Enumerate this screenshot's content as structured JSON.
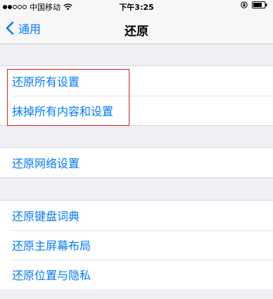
{
  "status_bar": {
    "carrier": "中国移动",
    "time": "下午3:25"
  },
  "nav": {
    "back_label": "通用",
    "title": "还原"
  },
  "groups": [
    {
      "items": [
        {
          "label": "还原所有设置"
        },
        {
          "label": "抹掉所有内容和设置"
        }
      ]
    },
    {
      "items": [
        {
          "label": "还原网络设置"
        }
      ]
    },
    {
      "items": [
        {
          "label": "还原键盘词典"
        },
        {
          "label": "还原主屏幕布局"
        },
        {
          "label": "还原位置与隐私"
        }
      ]
    }
  ],
  "colors": {
    "accent": "#007aff",
    "highlight": "#d0202a",
    "background": "#efeff4"
  }
}
